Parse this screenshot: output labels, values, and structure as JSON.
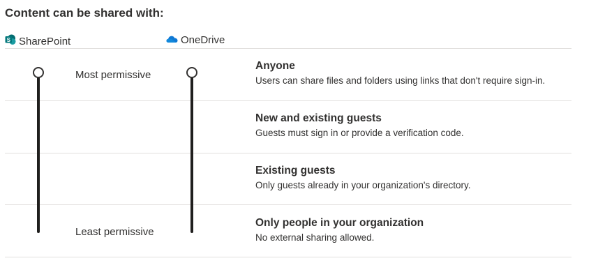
{
  "heading": "Content can be shared with:",
  "apps": {
    "sharepoint": {
      "label": "SharePoint",
      "icon": "sharepoint-icon"
    },
    "onedrive": {
      "label": "OneDrive",
      "icon": "onedrive-icon"
    }
  },
  "scale": {
    "most": "Most permissive",
    "least": "Least permissive"
  },
  "sliders": {
    "sharepoint_level": "Anyone",
    "onedrive_level": "Anyone"
  },
  "levels": [
    {
      "title": "Anyone",
      "desc": "Users can share files and folders using links that don't require sign-in."
    },
    {
      "title": "New and existing guests",
      "desc": "Guests must sign in or provide a verification code."
    },
    {
      "title": "Existing guests",
      "desc": "Only guests already in your organization's directory."
    },
    {
      "title": "Only people in your organization",
      "desc": "No external sharing allowed."
    }
  ],
  "colors": {
    "sharepoint_brand": "#038387",
    "onedrive_brand": "#0f78d4",
    "track": "#201f1e",
    "divider": "#e1dfdd"
  }
}
